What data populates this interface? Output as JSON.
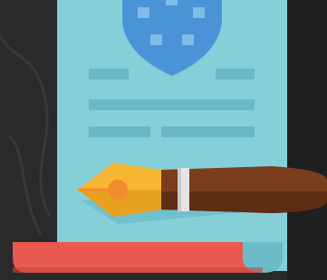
{
  "illustration": {
    "subject": "certificate-with-fountain-pen",
    "colors": {
      "background_dark": "#2b2b2b",
      "background_stone": "#3a3a3a",
      "paper": "#85cfd9",
      "paper_edge": "#6cbcc8",
      "text_lines": "#6ab8c4",
      "seal": "#4a93d6",
      "seal_squares": "#7fbcea",
      "scroll_roll": "#e9594f",
      "scroll_roll_shadow": "#c9443c",
      "nib": "#f8b733",
      "nib_shadow": "#e8a020",
      "nib_hole": "#f28a2e",
      "pen_body": "#7a3e1c",
      "pen_body_dark": "#5e2c12",
      "pen_band": "#e4e4e4"
    }
  }
}
